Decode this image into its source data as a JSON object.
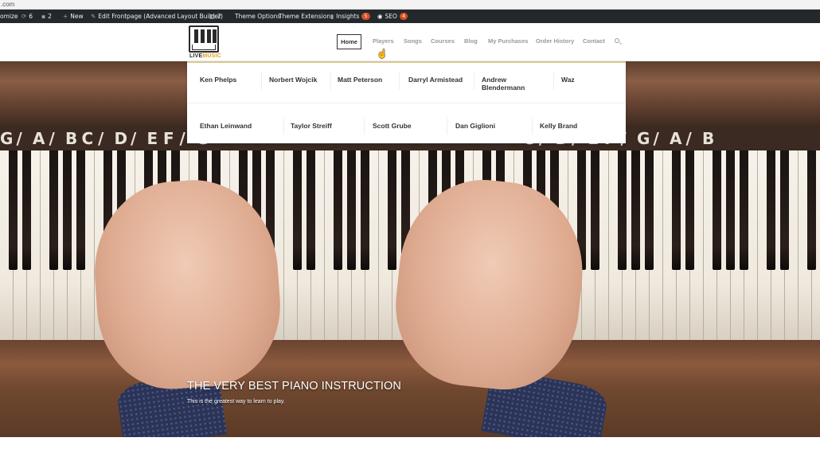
{
  "browser": {
    "url_fragment": ".com"
  },
  "admin_bar": {
    "customize": "omize",
    "updates_count": "6",
    "comments_count": "2",
    "new_label": "New",
    "edit_label": "Edit Frontpage (Advanced Layout Builder)",
    "wp_count": "2",
    "theme_options": "Theme Options",
    "theme_extensions": "Theme Extensions",
    "insights_label": "Insights",
    "insights_badge": "5",
    "seo_label": "SEO",
    "seo_badge": "4"
  },
  "logo": {
    "part1": "LIVE",
    "part2": "MUSIC"
  },
  "nav": {
    "home": "Home",
    "players": "Players",
    "songs": "Songs",
    "courses": "Courses",
    "blog": "Blog",
    "purchases": "My Purchases",
    "orders": "Order History",
    "contact": "Contact"
  },
  "players_menu": {
    "row1": [
      "Ken Phelps",
      "Norbert Wojcik",
      "Matt Peterson",
      "Darryl Armistead",
      "Andrew Blendermann",
      "Waz"
    ],
    "row2": [
      "Ethan Leinwand",
      "Taylor Streiff",
      "Scott Grube",
      "Dan Giglioni",
      "Kelly Brand"
    ]
  },
  "hero": {
    "title": "THE VERY BEST PIANO INSTRUCTION",
    "subtitle": "This is the greatest way to learn to play.",
    "key_letters": [
      "G",
      "/",
      "A",
      "/",
      "B",
      "C",
      "/",
      "D",
      "/",
      "E",
      "F",
      "/",
      "G",
      "C",
      "/",
      "D",
      "/",
      "E",
      "F",
      "/",
      "G",
      "/",
      "A",
      "/",
      "B"
    ]
  },
  "colors": {
    "admin_bar": "#23282d",
    "badge": "#d54e21",
    "logo_accent": "#e8a021",
    "menu_border": "#d7c98f"
  }
}
